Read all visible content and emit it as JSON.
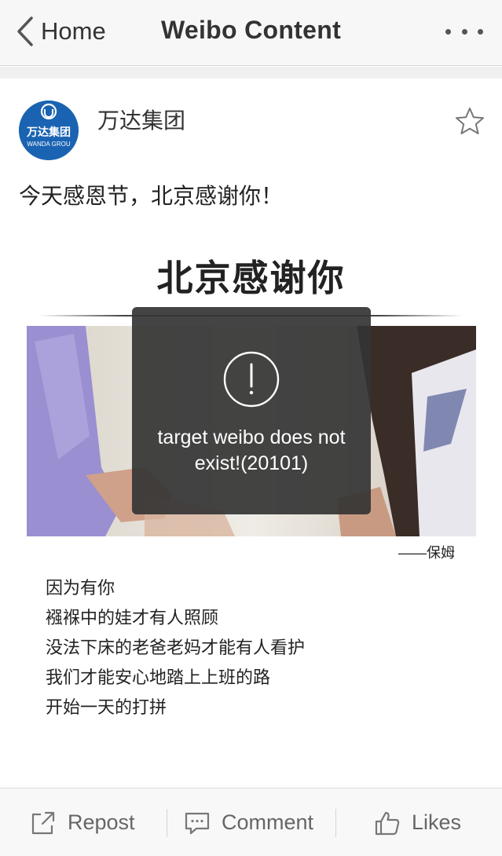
{
  "nav": {
    "back_label": "Home",
    "title": "Weibo Content",
    "more_icon": "more-dots-icon"
  },
  "post": {
    "author": "万达集团",
    "avatar": {
      "text": "万达集团",
      "subtext": "WANDA GROU"
    },
    "text": "今天感恩节，北京感谢你！",
    "favorite_icon": "star-icon",
    "image": {
      "headline": "北京感谢你",
      "signature": "——保姆",
      "lines": [
        "因为有你",
        "襁褓中的娃才有人照顾",
        "没法下床的老爸老妈才能有人看护",
        "我们才能安心地踏上上班的路",
        "开始一天的打拼"
      ]
    }
  },
  "toast": {
    "icon": "exclamation-circle-icon",
    "message": "target weibo does not exist!(20101)"
  },
  "toolbar": {
    "repost_label": "Repost",
    "comment_label": "Comment",
    "likes_label": "Likes"
  },
  "colors": {
    "brand_blue": "#1a63b2",
    "toast_bg": "#343434",
    "nav_bg": "#f7f7f7"
  }
}
